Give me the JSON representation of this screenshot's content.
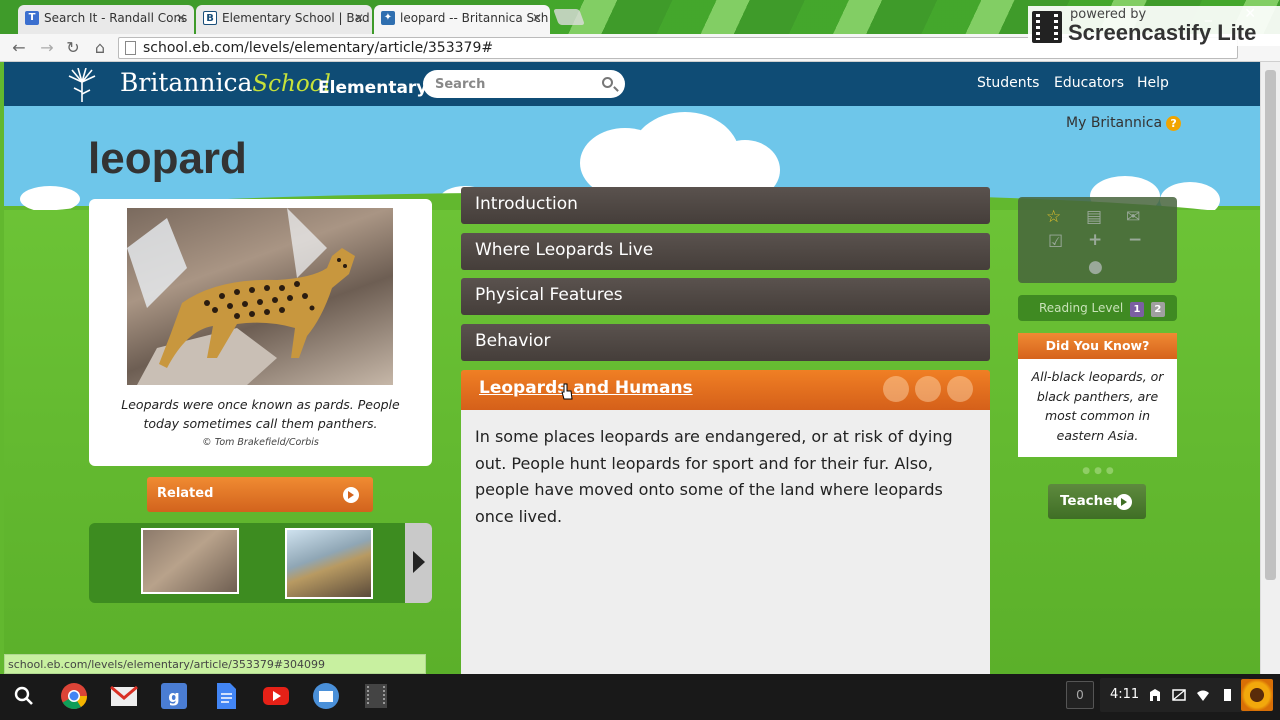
{
  "browser": {
    "tabs": [
      {
        "title": "Search It - Randall Cons",
        "favicon": "search-it-icon",
        "active": false
      },
      {
        "title": "Elementary School | Bad",
        "favicon": "britannica-b-icon",
        "active": false
      },
      {
        "title": "leopard -- Britannica Sch",
        "favicon": "britannica-icon",
        "active": true
      }
    ],
    "url": "school.eb.com/levels/elementary/article/353379#",
    "status_url": "school.eb.com/levels/elementary/article/353379#304099",
    "overlay": {
      "powered_by": "powered by",
      "name": "Screencastify Lite"
    }
  },
  "header": {
    "logo_main": "Britannica",
    "logo_script": "School",
    "level": "Elementary",
    "search_placeholder": "Search",
    "nav": [
      "Students",
      "Educators",
      "Help"
    ]
  },
  "article": {
    "title": "leopard",
    "my_britannica": "My Britannica",
    "help_mark": "?",
    "image_caption": "Leopards were once known as pards. People today sometimes call them panthers.",
    "image_credit": "© Tom Brakefield/Corbis",
    "related_label": "Related",
    "sections": [
      {
        "label": "Introduction",
        "active": false
      },
      {
        "label": "Where Leopards Live",
        "active": false
      },
      {
        "label": "Physical Features",
        "active": false
      },
      {
        "label": "Behavior",
        "active": false
      },
      {
        "label": "Leopards and Humans",
        "active": true
      }
    ],
    "active_text": "In some places leopards are endangered, or at risk of dying out. People hunt leopards for sport and for their fur. Also, people have moved onto some of the land where leopards once lived."
  },
  "sidebar": {
    "tools": [
      "star-icon",
      "print-icon",
      "email-icon",
      "checkmark-icon",
      "plus-icon",
      "minus-icon",
      "globe-icon"
    ],
    "reading_level_label": "Reading Level",
    "reading_levels": [
      "1",
      "2"
    ],
    "did_you_know_title": "Did You Know?",
    "did_you_know_text": "All-black leopards, or black panthers, are most common in eastern Asia.",
    "teacher_label": "Teacher"
  },
  "shelf": {
    "apps": [
      "search-icon",
      "chrome-icon",
      "gmail-icon",
      "google-plus-icon",
      "docs-icon",
      "youtube-icon",
      "files-icon",
      "video-icon"
    ],
    "notification_count": "0",
    "time": "4:11"
  },
  "colors": {
    "header_bg": "#0f4c75",
    "section_bg": "#4f4743",
    "active_section": "#e8701f",
    "grass": "#62b82f",
    "sky": "#6ec6ea"
  }
}
